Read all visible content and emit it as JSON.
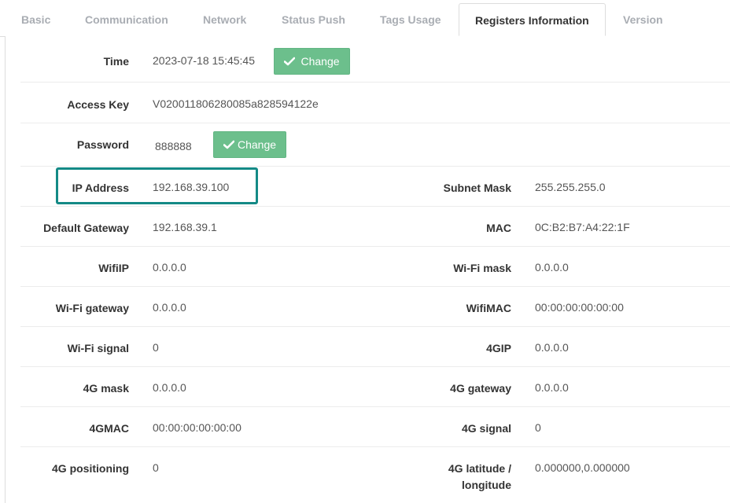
{
  "tabs": [
    {
      "label": "Basic"
    },
    {
      "label": "Communication"
    },
    {
      "label": "Network"
    },
    {
      "label": "Status Push"
    },
    {
      "label": "Tags Usage"
    },
    {
      "label": "Registers Information"
    },
    {
      "label": "Version"
    }
  ],
  "active_tab": "Registers Information",
  "fields": {
    "time": {
      "label": "Time",
      "value": "2023-07-18 15:45:45"
    },
    "access_key": {
      "label": "Access Key",
      "value": "V020011806280085a828594122e"
    },
    "password": {
      "label": "Password",
      "value": "888888"
    },
    "ip_address": {
      "label": "IP Address",
      "value": "192.168.39.100"
    },
    "subnet_mask": {
      "label": "Subnet Mask",
      "value": "255.255.255.0"
    },
    "default_gateway": {
      "label": "Default Gateway",
      "value": "192.168.39.1"
    },
    "mac": {
      "label": "MAC",
      "value": "0C:B2:B7:A4:22:1F"
    },
    "wifi_ip": {
      "label": "WifiIP",
      "value": "0.0.0.0"
    },
    "wifi_mask": {
      "label": "Wi-Fi mask",
      "value": "0.0.0.0"
    },
    "wifi_gateway": {
      "label": "Wi-Fi gateway",
      "value": "0.0.0.0"
    },
    "wifi_mac": {
      "label": "WifiMAC",
      "value": "00:00:00:00:00:00"
    },
    "wifi_signal": {
      "label": "Wi-Fi signal",
      "value": "0"
    },
    "g4_ip": {
      "label": "4GIP",
      "value": "0.0.0.0"
    },
    "g4_mask": {
      "label": "4G mask",
      "value": "0.0.0.0"
    },
    "g4_gateway": {
      "label": "4G gateway",
      "value": "0.0.0.0"
    },
    "g4_mac": {
      "label": "4GMAC",
      "value": "00:00:00:00:00:00"
    },
    "g4_signal": {
      "label": "4G signal",
      "value": "0"
    },
    "g4_positioning": {
      "label": "4G positioning",
      "value": "0"
    },
    "g4_latlon": {
      "label_line1": "4G latitude /",
      "label_line2": "longitude",
      "value": "0.000000,0.000000"
    }
  },
  "buttons": {
    "change_label": "Change"
  },
  "icons": {
    "check": "check-icon"
  },
  "colors": {
    "button_green": "#6cbf8c",
    "highlight_teal": "#148a86"
  }
}
